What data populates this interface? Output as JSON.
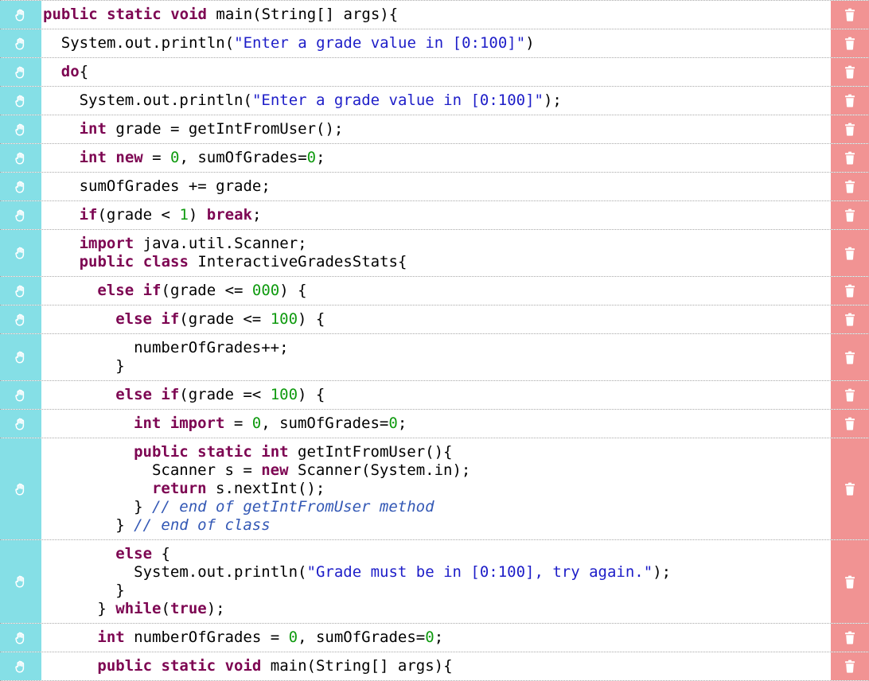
{
  "theme": {
    "handle_color": "#85dfe6",
    "trash_color": "#f19393",
    "keyword_color": "#7d0552",
    "string_color": "#1d1dc8",
    "number_color": "#0f9a0f",
    "comment_color": "#3358b5"
  },
  "icons": {
    "drag": "hand-grab-icon",
    "delete": "trash-icon"
  },
  "blocks": [
    {
      "indent": 0,
      "lines": [
        [
          [
            "kw",
            "public"
          ],
          [
            "t",
            " "
          ],
          [
            "kw",
            "static"
          ],
          [
            "t",
            " "
          ],
          [
            "kw",
            "void"
          ],
          [
            "t",
            " main(String[] args){"
          ]
        ]
      ]
    },
    {
      "indent": 1,
      "lines": [
        [
          [
            "t",
            "System.out.println("
          ],
          [
            "st",
            "\"Enter a grade value in [0:100]\""
          ],
          [
            "t",
            ")"
          ]
        ]
      ]
    },
    {
      "indent": 1,
      "lines": [
        [
          [
            "kw",
            "do"
          ],
          [
            "t",
            "{"
          ]
        ]
      ]
    },
    {
      "indent": 2,
      "lines": [
        [
          [
            "t",
            "System.out.println("
          ],
          [
            "st",
            "\"Enter a grade value in [0:100]\""
          ],
          [
            "t",
            ");"
          ]
        ]
      ]
    },
    {
      "indent": 2,
      "lines": [
        [
          [
            "kw",
            "int"
          ],
          [
            "t",
            " grade = getIntFromUser();"
          ]
        ]
      ]
    },
    {
      "indent": 2,
      "lines": [
        [
          [
            "kw",
            "int"
          ],
          [
            "t",
            " "
          ],
          [
            "kw",
            "new"
          ],
          [
            "t",
            " = "
          ],
          [
            "nm",
            "0"
          ],
          [
            "t",
            ", sumOfGrades="
          ],
          [
            "nm",
            "0"
          ],
          [
            "t",
            ";"
          ]
        ]
      ]
    },
    {
      "indent": 2,
      "lines": [
        [
          [
            "t",
            "sumOfGrades += grade;"
          ]
        ]
      ]
    },
    {
      "indent": 2,
      "lines": [
        [
          [
            "kw",
            "if"
          ],
          [
            "t",
            "(grade < "
          ],
          [
            "nm",
            "1"
          ],
          [
            "t",
            ") "
          ],
          [
            "kw",
            "break"
          ],
          [
            "t",
            ";"
          ]
        ]
      ]
    },
    {
      "indent": 2,
      "lines": [
        [
          [
            "kw",
            "import"
          ],
          [
            "t",
            " java.util.Scanner;"
          ]
        ],
        [
          [
            "kw",
            "public"
          ],
          [
            "t",
            " "
          ],
          [
            "kw",
            "class"
          ],
          [
            "t",
            " InteractiveGradesStats{"
          ]
        ]
      ]
    },
    {
      "indent": 3,
      "lines": [
        [
          [
            "kw",
            "else"
          ],
          [
            "t",
            " "
          ],
          [
            "kw",
            "if"
          ],
          [
            "t",
            "(grade <= "
          ],
          [
            "nm",
            "000"
          ],
          [
            "t",
            ") {"
          ]
        ]
      ]
    },
    {
      "indent": 4,
      "lines": [
        [
          [
            "kw",
            "else"
          ],
          [
            "t",
            " "
          ],
          [
            "kw",
            "if"
          ],
          [
            "t",
            "(grade <= "
          ],
          [
            "nm",
            "100"
          ],
          [
            "t",
            ") {"
          ]
        ]
      ]
    },
    {
      "indent": 4,
      "lines": [
        [
          [
            "t",
            "  numberOfGrades++;"
          ]
        ],
        [
          [
            "t",
            "}"
          ]
        ]
      ]
    },
    {
      "indent": 4,
      "lines": [
        [
          [
            "kw",
            "else"
          ],
          [
            "t",
            " "
          ],
          [
            "kw",
            "if"
          ],
          [
            "t",
            "(grade =< "
          ],
          [
            "nm",
            "100"
          ],
          [
            "t",
            ") {"
          ]
        ]
      ]
    },
    {
      "indent": 5,
      "lines": [
        [
          [
            "kw",
            "int"
          ],
          [
            "t",
            " "
          ],
          [
            "kw",
            "import"
          ],
          [
            "t",
            " = "
          ],
          [
            "nm",
            "0"
          ],
          [
            "t",
            ", sumOfGrades="
          ],
          [
            "nm",
            "0"
          ],
          [
            "t",
            ";"
          ]
        ]
      ]
    },
    {
      "indent": 4,
      "lines": [
        [
          [
            "t",
            "  "
          ],
          [
            "kw",
            "public"
          ],
          [
            "t",
            " "
          ],
          [
            "kw",
            "static"
          ],
          [
            "t",
            " "
          ],
          [
            "kw",
            "int"
          ],
          [
            "t",
            " getIntFromUser(){"
          ]
        ],
        [
          [
            "t",
            "    Scanner s = "
          ],
          [
            "kw",
            "new"
          ],
          [
            "t",
            " Scanner(System.in);"
          ]
        ],
        [
          [
            "t",
            "    "
          ],
          [
            "kw",
            "return"
          ],
          [
            "t",
            " s.nextInt();"
          ]
        ],
        [
          [
            "t",
            "  } "
          ],
          [
            "cm",
            "// end of getIntFromUser method"
          ]
        ],
        [
          [
            "t",
            "} "
          ],
          [
            "cm",
            "// end of class"
          ]
        ]
      ]
    },
    {
      "indent": 3,
      "lines": [
        [
          [
            "t",
            "  "
          ],
          [
            "kw",
            "else"
          ],
          [
            "t",
            " {"
          ]
        ],
        [
          [
            "t",
            "    System.out.println("
          ],
          [
            "st",
            "\"Grade must be in [0:100], try again.\""
          ],
          [
            "t",
            ");"
          ]
        ],
        [
          [
            "t",
            "  }"
          ]
        ],
        [
          [
            "t",
            "} "
          ],
          [
            "kw",
            "while"
          ],
          [
            "t",
            "("
          ],
          [
            "kw",
            "true"
          ],
          [
            "t",
            ");"
          ]
        ]
      ]
    },
    {
      "indent": 3,
      "lines": [
        [
          [
            "kw",
            "int"
          ],
          [
            "t",
            " numberOfGrades = "
          ],
          [
            "nm",
            "0"
          ],
          [
            "t",
            ", sumOfGrades="
          ],
          [
            "nm",
            "0"
          ],
          [
            "t",
            ";"
          ]
        ]
      ]
    },
    {
      "indent": 3,
      "lines": [
        [
          [
            "kw",
            "public"
          ],
          [
            "t",
            " "
          ],
          [
            "kw",
            "static"
          ],
          [
            "t",
            " "
          ],
          [
            "kw",
            "void"
          ],
          [
            "t",
            " main(String[] args){"
          ]
        ]
      ]
    }
  ]
}
